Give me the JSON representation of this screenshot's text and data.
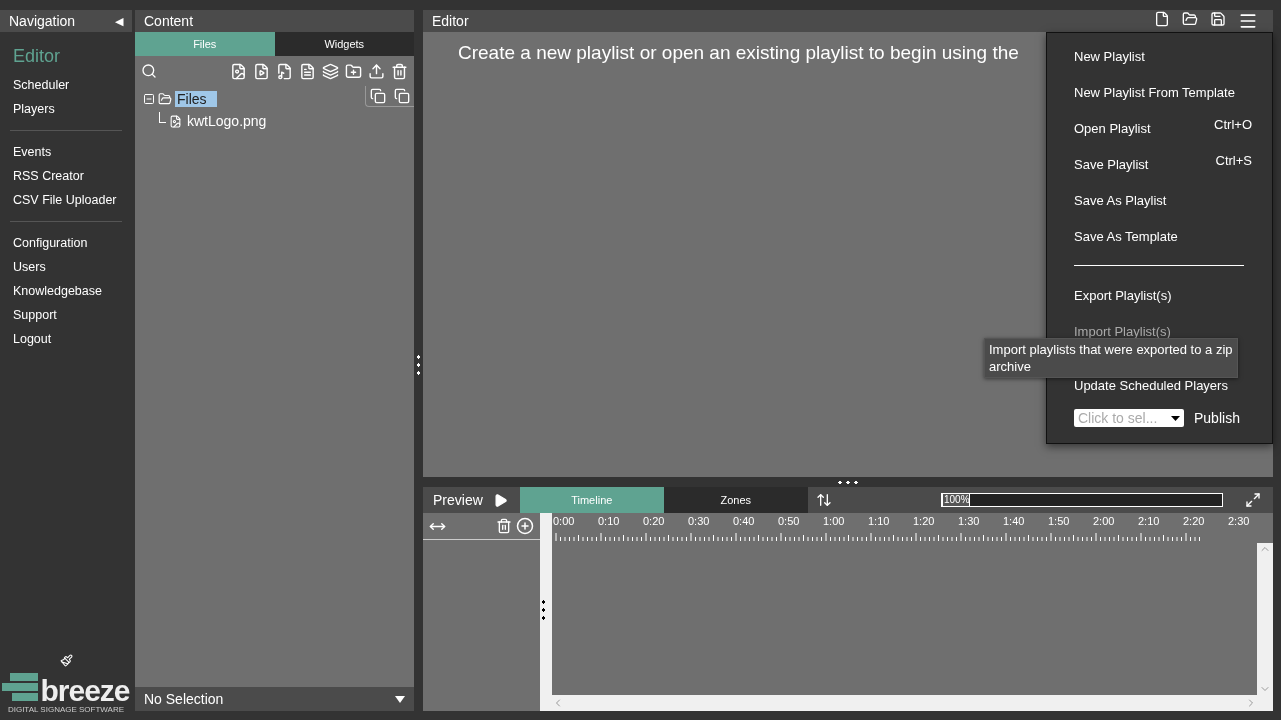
{
  "navigation": {
    "title": "Navigation",
    "collapse": "◀",
    "groups": [
      [
        {
          "label": "Editor",
          "selected": true
        },
        {
          "label": "Scheduler",
          "selected": false
        },
        {
          "label": "Players",
          "selected": false
        }
      ],
      [
        {
          "label": "Events",
          "selected": false
        },
        {
          "label": "RSS Creator",
          "selected": false
        },
        {
          "label": "CSV File Uploader",
          "selected": false
        }
      ],
      [
        {
          "label": "Configuration",
          "selected": false
        },
        {
          "label": "Users",
          "selected": false
        },
        {
          "label": "Knowledgebase",
          "selected": false
        },
        {
          "label": "Support",
          "selected": false
        },
        {
          "label": "Logout",
          "selected": false
        }
      ]
    ],
    "logo": {
      "name": "breeze",
      "tagline": "DIGITAL SIGNAGE SOFTWARE"
    }
  },
  "content": {
    "title": "Content",
    "tabs": [
      {
        "label": "Files",
        "selected": true
      },
      {
        "label": "Widgets",
        "selected": false
      }
    ],
    "tree": [
      {
        "label": "Files",
        "expanded": true,
        "selected": true,
        "children": [
          {
            "label": "kwtLogo.png",
            "selected": false
          }
        ]
      }
    ],
    "footer": {
      "value": "No Selection"
    }
  },
  "editor": {
    "title": "Editor",
    "message": "Create a new playlist or open an existing playlist to begin using the",
    "menu": [
      {
        "kind": "item",
        "label": "New Playlist",
        "disabled": false
      },
      {
        "kind": "item",
        "label": "New Playlist From Template",
        "disabled": false
      },
      {
        "kind": "item",
        "label": "Open Playlist",
        "shortcut": "Ctrl+O",
        "disabled": false
      },
      {
        "kind": "item",
        "label": "Save Playlist",
        "shortcut": "Ctrl+S",
        "disabled": false
      },
      {
        "kind": "item",
        "label": "Save As Playlist",
        "disabled": false
      },
      {
        "kind": "item",
        "label": "Save As Template",
        "disabled": false
      },
      {
        "kind": "separator"
      },
      {
        "kind": "item",
        "label": "Export Playlist(s)",
        "disabled": false
      },
      {
        "kind": "item",
        "label": "Import Playlist(s)",
        "disabled": true
      },
      {
        "kind": "item",
        "label": "Update Scheduled Players",
        "disabled": false
      },
      {
        "kind": "publish",
        "placeholder": "Click to sel...",
        "button": "Publish"
      }
    ],
    "tooltip": "Import playlists that were exported to a zip archive"
  },
  "preview": {
    "title": "Preview",
    "tabs": [
      {
        "label": "Timeline",
        "selected": true
      },
      {
        "label": "Zones",
        "selected": false
      }
    ],
    "zoom": {
      "label": "100%",
      "level": 0
    },
    "ruler": [
      "0:00",
      "0:10",
      "0:20",
      "0:30",
      "0:40",
      "0:50",
      "1:00",
      "1:10",
      "1:20",
      "1:30",
      "1:40",
      "1:50",
      "2:00",
      "2:10",
      "2:20",
      "2:30"
    ]
  }
}
